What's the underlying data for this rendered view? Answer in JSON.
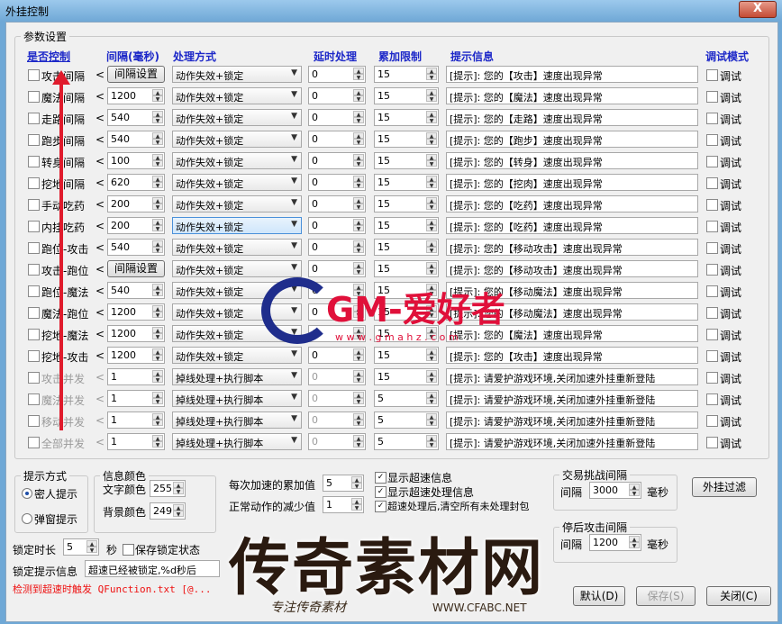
{
  "window": {
    "title": "外挂控制",
    "close_glyph": "X"
  },
  "groups": {
    "params": "参数设置",
    "prompt_mode": "提示方式",
    "info_color": "信息颜色",
    "trade_interval": "交易挑战间隔",
    "after_attack": "停后攻击间隔"
  },
  "headers": {
    "control": "是否控制",
    "interval": "间隔(毫秒)",
    "method": "处理方式",
    "delay": "延时处理",
    "accumulate": "累加限制",
    "info": "提示信息",
    "debug": "调试模式"
  },
  "rows": [
    {
      "label": "攻击间隔",
      "interval": "间隔设置",
      "interval_is_button": true,
      "method": "动作失效+锁定",
      "delay": "0",
      "limit": "15",
      "info": "[提示]: 您的【攻击】速度出现异常",
      "debug": "调试",
      "disabled": false,
      "selected": false
    },
    {
      "label": "魔法间隔",
      "interval": "1200",
      "interval_is_button": false,
      "method": "动作失效+锁定",
      "delay": "0",
      "limit": "15",
      "info": "[提示]: 您的【魔法】速度出现异常",
      "debug": "调试",
      "disabled": false,
      "selected": false
    },
    {
      "label": "走路间隔",
      "interval": "540",
      "interval_is_button": false,
      "method": "动作失效+锁定",
      "delay": "0",
      "limit": "15",
      "info": "[提示]: 您的【走路】速度出现异常",
      "debug": "调试",
      "disabled": false,
      "selected": false
    },
    {
      "label": "跑步间隔",
      "interval": "540",
      "interval_is_button": false,
      "method": "动作失效+锁定",
      "delay": "0",
      "limit": "15",
      "info": "[提示]: 您的【跑步】速度出现异常",
      "debug": "调试",
      "disabled": false,
      "selected": false
    },
    {
      "label": "转身间隔",
      "interval": "100",
      "interval_is_button": false,
      "method": "动作失效+锁定",
      "delay": "0",
      "limit": "15",
      "info": "[提示]: 您的【转身】速度出现异常",
      "debug": "调试",
      "disabled": false,
      "selected": false
    },
    {
      "label": "挖地间隔",
      "interval": "620",
      "interval_is_button": false,
      "method": "动作失效+锁定",
      "delay": "0",
      "limit": "15",
      "info": "[提示]: 您的【挖肉】速度出现异常",
      "debug": "调试",
      "disabled": false,
      "selected": false
    },
    {
      "label": "手动吃药",
      "interval": "200",
      "interval_is_button": false,
      "method": "动作失效+锁定",
      "delay": "0",
      "limit": "15",
      "info": "[提示]: 您的【吃药】速度出现异常",
      "debug": "调试",
      "disabled": false,
      "selected": false
    },
    {
      "label": "内挂吃药",
      "interval": "200",
      "interval_is_button": false,
      "method": "动作失效+锁定",
      "delay": "0",
      "limit": "15",
      "info": "[提示]: 您的【吃药】速度出现异常",
      "debug": "调试",
      "disabled": false,
      "selected": true
    },
    {
      "label": "跑位-攻击",
      "interval": "540",
      "interval_is_button": false,
      "method": "动作失效+锁定",
      "delay": "0",
      "limit": "15",
      "info": "[提示]: 您的【移动攻击】速度出现异常",
      "debug": "调试",
      "disabled": false,
      "selected": false
    },
    {
      "label": "攻击-跑位",
      "interval": "间隔设置",
      "interval_is_button": true,
      "method": "动作失效+锁定",
      "delay": "0",
      "limit": "15",
      "info": "[提示]: 您的【移动攻击】速度出现异常",
      "debug": "调试",
      "disabled": false,
      "selected": false
    },
    {
      "label": "跑位-魔法",
      "interval": "540",
      "interval_is_button": false,
      "method": "动作失效+锁定",
      "delay": "0",
      "limit": "15",
      "info": "[提示]: 您的【移动魔法】速度出现异常",
      "debug": "调试",
      "disabled": false,
      "selected": false
    },
    {
      "label": "魔法-跑位",
      "interval": "1200",
      "interval_is_button": false,
      "method": "动作失效+锁定",
      "delay": "0",
      "limit": "15",
      "info": "[提示]: 您的【移动魔法】速度出现异常",
      "debug": "调试",
      "disabled": false,
      "selected": false
    },
    {
      "label": "挖地-魔法",
      "interval": "1200",
      "interval_is_button": false,
      "method": "动作失效+锁定",
      "delay": "0",
      "limit": "15",
      "info": "[提示]: 您的【魔法】速度出现异常",
      "debug": "调试",
      "disabled": false,
      "selected": false
    },
    {
      "label": "挖地-攻击",
      "interval": "1200",
      "interval_is_button": false,
      "method": "动作失效+锁定",
      "delay": "0",
      "limit": "15",
      "info": "[提示]: 您的【攻击】速度出现异常",
      "debug": "调试",
      "disabled": false,
      "selected": false
    },
    {
      "label": "攻击并发",
      "interval": "1",
      "interval_is_button": false,
      "method": "掉线处理+执行脚本",
      "delay": "0",
      "limit": "15",
      "info": "[提示]: 请爱护游戏环境,关闭加速外挂重新登陆",
      "debug": "调试",
      "disabled": true,
      "selected": false
    },
    {
      "label": "魔法并发",
      "interval": "1",
      "interval_is_button": false,
      "method": "掉线处理+执行脚本",
      "delay": "0",
      "limit": "5",
      "info": "[提示]: 请爱护游戏环境,关闭加速外挂重新登陆",
      "debug": "调试",
      "disabled": true,
      "selected": false
    },
    {
      "label": "移动并发",
      "interval": "1",
      "interval_is_button": false,
      "method": "掉线处理+执行脚本",
      "delay": "0",
      "limit": "5",
      "info": "[提示]: 请爱护游戏环境,关闭加速外挂重新登陆",
      "debug": "调试",
      "disabled": true,
      "selected": false
    },
    {
      "label": "全部并发",
      "interval": "1",
      "interval_is_button": false,
      "method": "掉线处理+执行脚本",
      "delay": "0",
      "limit": "5",
      "info": "[提示]: 请爱护游戏环境,关闭加速外挂重新登陆",
      "debug": "调试",
      "disabled": true,
      "selected": false
    }
  ],
  "prompt_mode": {
    "opt1": "密人提示",
    "opt2": "弹窗提示",
    "selected": "opt1"
  },
  "info_color": {
    "text_label": "文字颜色",
    "text_value": "255",
    "bg_label": "背景颜色",
    "bg_value": "249"
  },
  "accel": {
    "each_accumulate_label": "每次加速的累加值",
    "each_accumulate_value": "5",
    "normal_decrease_label": "正常动作的减少值",
    "normal_decrease_value": "1"
  },
  "options": {
    "show_speed_info": "显示超速信息",
    "show_speed_handle": "显示超速处理信息",
    "clear_after": "超速处理后,清空所有未处理封包"
  },
  "trade": {
    "label": "间隔",
    "value": "3000",
    "unit": "毫秒"
  },
  "after": {
    "label": "间隔",
    "value": "1200",
    "unit": "毫秒"
  },
  "filter_button": "外挂过滤",
  "lock": {
    "label": "锁定时长",
    "value": "5",
    "unit": "秒",
    "save_state": "保存锁定状态"
  },
  "lock_info": {
    "label": "锁定提示信息",
    "value": "超速已经被锁定,%d秒后"
  },
  "status": "检测到超速时触发 QFunction.txt [@...",
  "buttons": {
    "default": "默认(D)",
    "save": "保存(S)",
    "close": "关闭(C)"
  },
  "watermark": {
    "gm_text": "GM-爱好者",
    "gm_url": "w w w . g m a h z . c o m",
    "cq_text": "传奇素材网",
    "cq_sub": "专注传奇素材",
    "cq_url": "WWW.CFABC.NET"
  },
  "colors": {
    "header": "#1d28c8",
    "title_bg": "#6fa8d6",
    "status": "#e11111",
    "gm_red": "#e0103a",
    "gm_blue": "#1f2d8c"
  }
}
